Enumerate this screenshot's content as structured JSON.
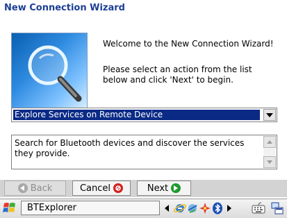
{
  "wizard": {
    "title": "New Connection Wizard",
    "welcome": "Welcome to the New Connection Wizard!",
    "instructions": "Please select an action from the list below and click 'Next' to begin."
  },
  "action_select": {
    "selected": "Explore Services on Remote Device"
  },
  "description": {
    "text": "Search for Bluetooth devices and discover the services they provide."
  },
  "buttons": {
    "back": "Back",
    "cancel": "Cancel",
    "next": "Next"
  },
  "taskbar": {
    "app_name": "BTExplorer",
    "icons": [
      "start-flag-icon",
      "scroll-left-icon",
      "internet-explorer-icon",
      "network-icon",
      "bluetooth-activity-icon",
      "bluetooth-icon",
      "scroll-right-icon",
      "keyboard-icon",
      "display-icon"
    ]
  },
  "colors": {
    "title": "#1c3f95",
    "selection": "#0a2a86",
    "button_bar": "#d3d3d3",
    "next_icon": "#1e9a2e",
    "cancel_icon": "#d42020"
  }
}
